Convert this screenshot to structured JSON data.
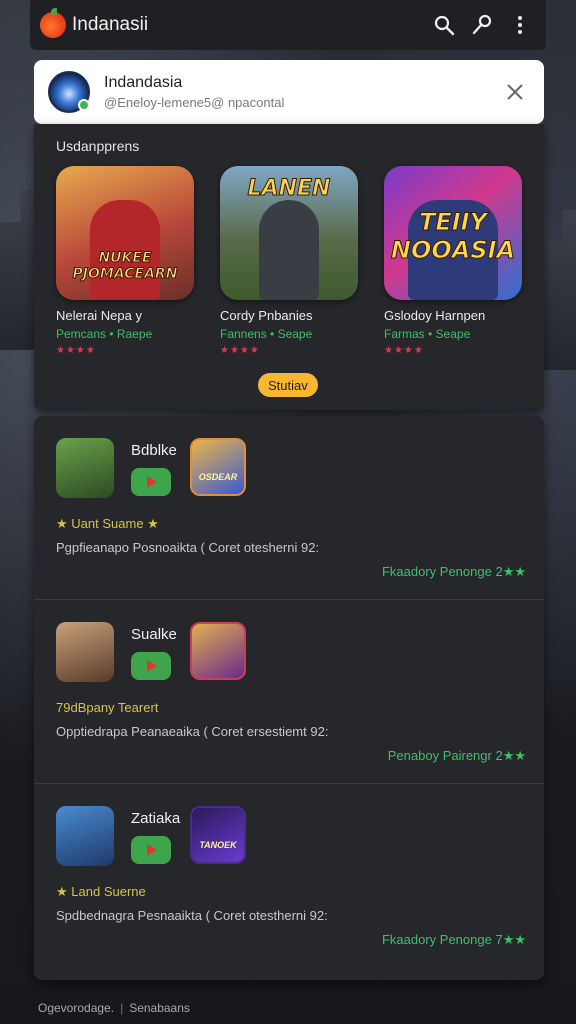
{
  "app": {
    "title": "Indanasii"
  },
  "account": {
    "name": "Indandasia",
    "email": "@Eneloy-lemene5@ npacontal"
  },
  "featured": {
    "section_title": "Usdanpprens",
    "items": [
      {
        "name": "Nelerai Nepa y",
        "subtitle": "Pemcans • Raepe",
        "stars": "★★★★",
        "art_text": "NUKEE PJOMACEARN"
      },
      {
        "name": "Cordy Pnbanies",
        "subtitle": "Fannens • Seape",
        "stars": "★★★★",
        "art_text": "LANEN"
      },
      {
        "name": "Gslodoy Harnpen",
        "subtitle": "Farmas • Seape",
        "stars": "★★★★",
        "art_text": "TEIIY NOOASIA"
      }
    ],
    "more_label": "Stutiav"
  },
  "list": [
    {
      "name": "Bdblke",
      "tile_text": "OSDEAR",
      "tag": "Uant Suame",
      "description": "Pgpfieanapo Posnoaikta ( Coret otesherni 92:",
      "meta": "Fkaadory Penonge 2"
    },
    {
      "name": "Sualke",
      "tile_text": "",
      "tag": "79dBpany Tearert",
      "description": "Opptiedrapa Peanaeaika ( Coret ersestiemt 92:",
      "meta": "Penaboy Pairengr 2"
    },
    {
      "name": "Zatiaka",
      "tile_text": "TANOEK",
      "tag": "Land Suerne",
      "description": "Spdbednagra Pesnaaikta ( Coret otestherni 92:",
      "meta": "Fkaadory Penonge 7"
    }
  ],
  "footer": {
    "left": "Ogevorodage.",
    "right": "Senabaans"
  },
  "colors": {
    "accent_green": "#3fbf6a",
    "play_green": "#3fa54c",
    "pill_yellow": "#f7b733",
    "star_red": "#e0394a",
    "card_bg": "#26272b"
  },
  "icons": [
    "app-logo-icon",
    "search-icon",
    "key-icon",
    "more-vert-icon",
    "close-icon",
    "play-icon",
    "star-icon"
  ]
}
